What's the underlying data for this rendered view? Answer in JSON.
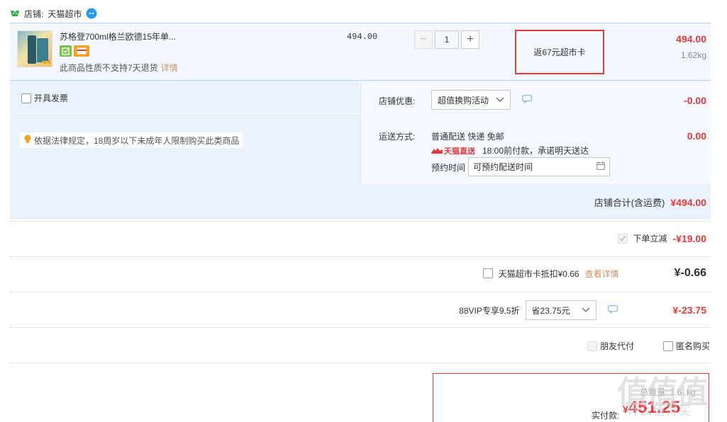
{
  "shop": {
    "prefix": "店铺:",
    "name": "天猫超市"
  },
  "item": {
    "title": "苏格登700ml格兰欧德15年单...",
    "thumb_tag": "475",
    "note": "此商品性质不支持7天退货",
    "note_link": "详情",
    "unit_price": "494.00",
    "qty": "1",
    "qty_minus": "−",
    "qty_plus": "+",
    "rebate": "返67元超市卡",
    "total": "494.00",
    "weight": "1.62kg"
  },
  "invoice_label": "开具发票",
  "legal_note": "依据法律规定，18周岁以下未成年人限制购买此类商品",
  "shop_promo": {
    "label": "店铺优惠:",
    "selected": "超值换购活动",
    "amount": "-0.00"
  },
  "shipping": {
    "label": "运送方式:",
    "method": "普通配送 快递 免邮",
    "tmall_badge": "天猫直送",
    "promise": "18:00前付款，承诺明天送达",
    "appoint_label": "预约时间",
    "appoint_value": "可预约配送时间",
    "fee": "0.00"
  },
  "subtotal": {
    "label": "店铺合计(含运费)",
    "value": "¥494.00"
  },
  "discount_row": {
    "label": "下单立减",
    "value": "-¥19.00"
  },
  "card_row": {
    "label": "天猫超市卡抵扣¥0.66",
    "link": "查看详情",
    "value": "¥-0.66"
  },
  "vip_row": {
    "label": "88VIP专享9.5折",
    "selected": "省23.75元",
    "value": "¥-23.75"
  },
  "options": {
    "friend_pay": "朋友代付",
    "anonymous": "匿名购买"
  },
  "summary": {
    "weight": "总重量: 1.6..kg",
    "pay_label": "实付款:",
    "currency": "¥",
    "pay_value": "451.25"
  },
  "watermark": {
    "big": "值值值",
    "small": "什么值得买"
  },
  "colors": {
    "accent": "#e4393c",
    "band": "#eaf3fd",
    "link": "#c8926a",
    "border": "#b2d1ff"
  }
}
